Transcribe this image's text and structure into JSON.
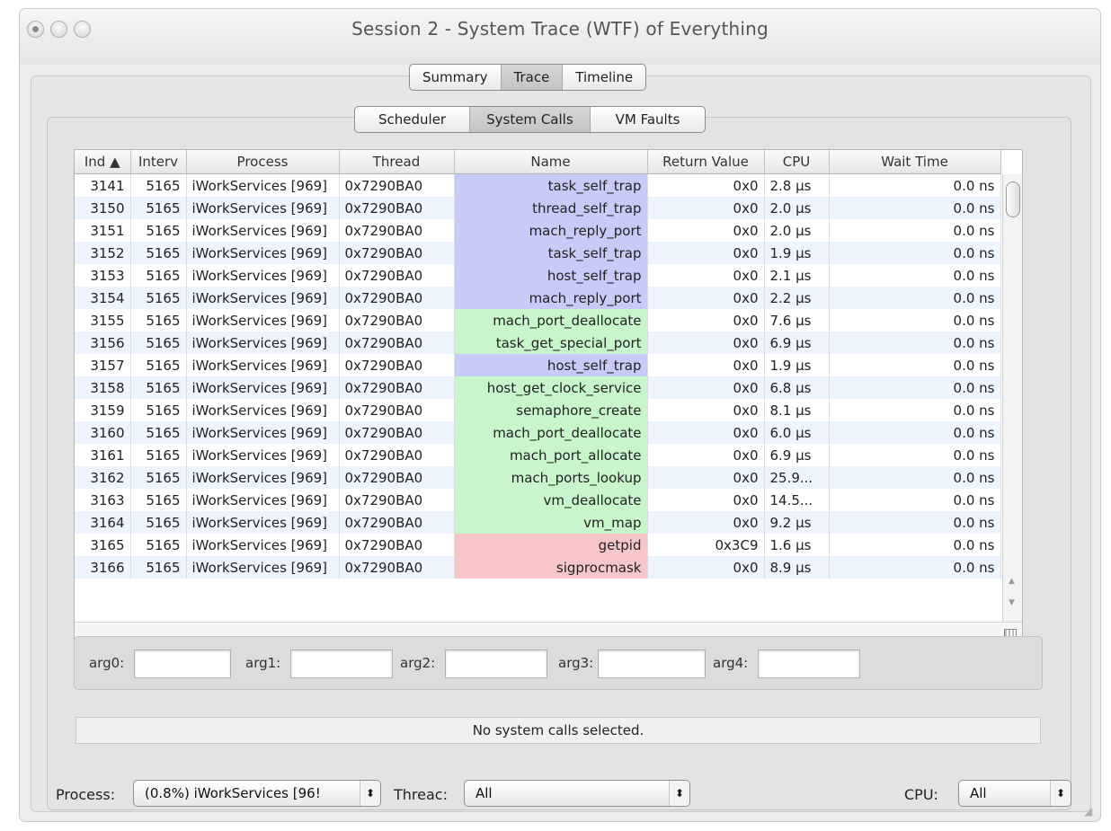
{
  "window": {
    "title": "Session 2 - System Trace (WTF) of Everything"
  },
  "top_tabs": [
    {
      "label": "Summary",
      "active": false
    },
    {
      "label": "Trace",
      "active": true
    },
    {
      "label": "Timeline",
      "active": false
    }
  ],
  "sub_tabs": [
    {
      "label": "Scheduler",
      "active": false
    },
    {
      "label": "System Calls",
      "active": true
    },
    {
      "label": "VM Faults",
      "active": false
    }
  ],
  "table": {
    "columns": [
      "Ind ▲",
      "Interv",
      "Process",
      "Thread",
      "Name",
      "Return Value",
      "CPU",
      "Wait Time"
    ],
    "rows": [
      {
        "ind": "3141",
        "interv": "5165",
        "process": "iWorkServices [969]",
        "thread": "0x7290BA0",
        "name": "task_self_trap",
        "color": "blue",
        "ret": "0x0",
        "cpu": "2.8 µs",
        "wait": "0.0 ns"
      },
      {
        "ind": "3150",
        "interv": "5165",
        "process": "iWorkServices [969]",
        "thread": "0x7290BA0",
        "name": "thread_self_trap",
        "color": "blue",
        "ret": "0x0",
        "cpu": "2.0 µs",
        "wait": "0.0 ns"
      },
      {
        "ind": "3151",
        "interv": "5165",
        "process": "iWorkServices [969]",
        "thread": "0x7290BA0",
        "name": "mach_reply_port",
        "color": "blue",
        "ret": "0x0",
        "cpu": "2.0 µs",
        "wait": "0.0 ns"
      },
      {
        "ind": "3152",
        "interv": "5165",
        "process": "iWorkServices [969]",
        "thread": "0x7290BA0",
        "name": "task_self_trap",
        "color": "blue",
        "ret": "0x0",
        "cpu": "1.9 µs",
        "wait": "0.0 ns"
      },
      {
        "ind": "3153",
        "interv": "5165",
        "process": "iWorkServices [969]",
        "thread": "0x7290BA0",
        "name": "host_self_trap",
        "color": "blue",
        "ret": "0x0",
        "cpu": "2.1 µs",
        "wait": "0.0 ns"
      },
      {
        "ind": "3154",
        "interv": "5165",
        "process": "iWorkServices [969]",
        "thread": "0x7290BA0",
        "name": "mach_reply_port",
        "color": "blue",
        "ret": "0x0",
        "cpu": "2.2 µs",
        "wait": "0.0 ns"
      },
      {
        "ind": "3155",
        "interv": "5165",
        "process": "iWorkServices [969]",
        "thread": "0x7290BA0",
        "name": "mach_port_deallocate",
        "color": "green",
        "ret": "0x0",
        "cpu": "7.6 µs",
        "wait": "0.0 ns"
      },
      {
        "ind": "3156",
        "interv": "5165",
        "process": "iWorkServices [969]",
        "thread": "0x7290BA0",
        "name": "task_get_special_port",
        "color": "green",
        "ret": "0x0",
        "cpu": "6.9 µs",
        "wait": "0.0 ns"
      },
      {
        "ind": "3157",
        "interv": "5165",
        "process": "iWorkServices [969]",
        "thread": "0x7290BA0",
        "name": "host_self_trap",
        "color": "blue",
        "ret": "0x0",
        "cpu": "1.9 µs",
        "wait": "0.0 ns"
      },
      {
        "ind": "3158",
        "interv": "5165",
        "process": "iWorkServices [969]",
        "thread": "0x7290BA0",
        "name": "host_get_clock_service",
        "color": "green",
        "ret": "0x0",
        "cpu": "6.8 µs",
        "wait": "0.0 ns"
      },
      {
        "ind": "3159",
        "interv": "5165",
        "process": "iWorkServices [969]",
        "thread": "0x7290BA0",
        "name": "semaphore_create",
        "color": "green",
        "ret": "0x0",
        "cpu": "8.1 µs",
        "wait": "0.0 ns"
      },
      {
        "ind": "3160",
        "interv": "5165",
        "process": "iWorkServices [969]",
        "thread": "0x7290BA0",
        "name": "mach_port_deallocate",
        "color": "green",
        "ret": "0x0",
        "cpu": "6.0 µs",
        "wait": "0.0 ns"
      },
      {
        "ind": "3161",
        "interv": "5165",
        "process": "iWorkServices [969]",
        "thread": "0x7290BA0",
        "name": "mach_port_allocate",
        "color": "green",
        "ret": "0x0",
        "cpu": "6.9 µs",
        "wait": "0.0 ns"
      },
      {
        "ind": "3162",
        "interv": "5165",
        "process": "iWorkServices [969]",
        "thread": "0x7290BA0",
        "name": "mach_ports_lookup",
        "color": "green",
        "ret": "0x0",
        "cpu": "25.9...",
        "wait": "0.0 ns"
      },
      {
        "ind": "3163",
        "interv": "5165",
        "process": "iWorkServices [969]",
        "thread": "0x7290BA0",
        "name": "vm_deallocate",
        "color": "green",
        "ret": "0x0",
        "cpu": "14.5...",
        "wait": "0.0 ns"
      },
      {
        "ind": "3164",
        "interv": "5165",
        "process": "iWorkServices [969]",
        "thread": "0x7290BA0",
        "name": "vm_map",
        "color": "green",
        "ret": "0x0",
        "cpu": "9.2 µs",
        "wait": "0.0 ns"
      },
      {
        "ind": "3165",
        "interv": "5165",
        "process": "iWorkServices [969]",
        "thread": "0x7290BA0",
        "name": "getpid",
        "color": "red",
        "ret": "0x3C9",
        "cpu": "1.6 µs",
        "wait": "0.0 ns"
      },
      {
        "ind": "3166",
        "interv": "5165",
        "process": "iWorkServices [969]",
        "thread": "0x7290BA0",
        "name": "sigprocmask",
        "color": "red",
        "ret": "0x0",
        "cpu": "8.9 µs",
        "wait": "0.0 ns"
      }
    ]
  },
  "args": [
    {
      "label": "arg0:",
      "value": ""
    },
    {
      "label": "arg1:",
      "value": ""
    },
    {
      "label": "arg2:",
      "value": ""
    },
    {
      "label": "arg3:",
      "value": ""
    },
    {
      "label": "arg4:",
      "value": ""
    }
  ],
  "status": "No system calls selected.",
  "bottom": {
    "process_label": "Process:",
    "process_value": "(0.8%) iWorkServices [96!",
    "thread_label": "Threac:",
    "thread_value": "All",
    "cpu_label": "CPU:",
    "cpu_value": "All"
  },
  "colors": {
    "blue": "#c8cbf8",
    "green": "#c8f5cc",
    "red": "#f7c6c8"
  },
  "icons": [
    "close-icon",
    "minimize-icon",
    "maximize-icon",
    "sort-ascending-icon",
    "chevron-updown-icon",
    "resize-grip-icon"
  ]
}
